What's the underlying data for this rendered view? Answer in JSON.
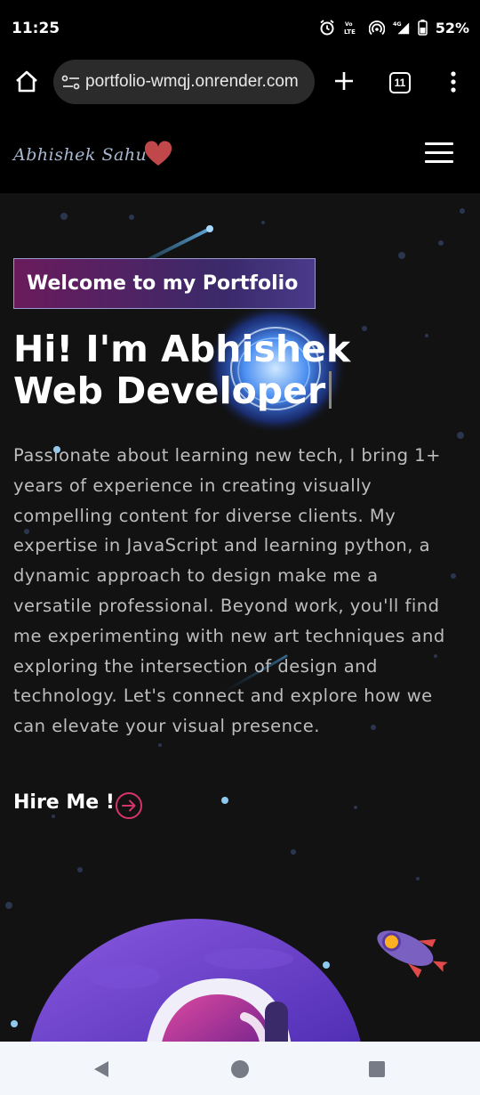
{
  "status_bar": {
    "time": "11:25",
    "battery": "52%",
    "icons": [
      "alarm-icon",
      "volte-icon",
      "hotspot-icon",
      "4g-signal-icon",
      "battery-icon"
    ]
  },
  "browser": {
    "url": "portfolio-wmqj.onrender.com",
    "tab_count": "11",
    "icons": [
      "home-icon",
      "site-settings-icon",
      "plus-icon",
      "tabs-icon",
      "more-vert-icon"
    ]
  },
  "header": {
    "logo": "Abhishek Sahu",
    "logo_icon": "heart-icon",
    "menu_icon": "hamburger-icon",
    "accent_color": "#c0474a"
  },
  "hero": {
    "tagline": "Welcome to my Portfolio",
    "title_line1": "Hi! I'm Abhishek",
    "title_line2": "Web Developer",
    "description": "Passionate about learning new tech, I bring 1+ years of experience in creating visually compelling content for diverse clients. My expertise in JavaScript and learning python, a dynamic approach to design make me a versatile professional. Beyond work, you'll find me experimenting with new art techniques and exploring the intersection of design and technology. Let's connect and explore how we can elevate your visual presence.",
    "cta_label": "Hire Me !",
    "cta_icon": "arrow-circle-right-icon",
    "cta_color": "#d6336c"
  },
  "nav_bar": {
    "icons": [
      "back-icon",
      "home-circle-icon",
      "recents-icon"
    ]
  }
}
